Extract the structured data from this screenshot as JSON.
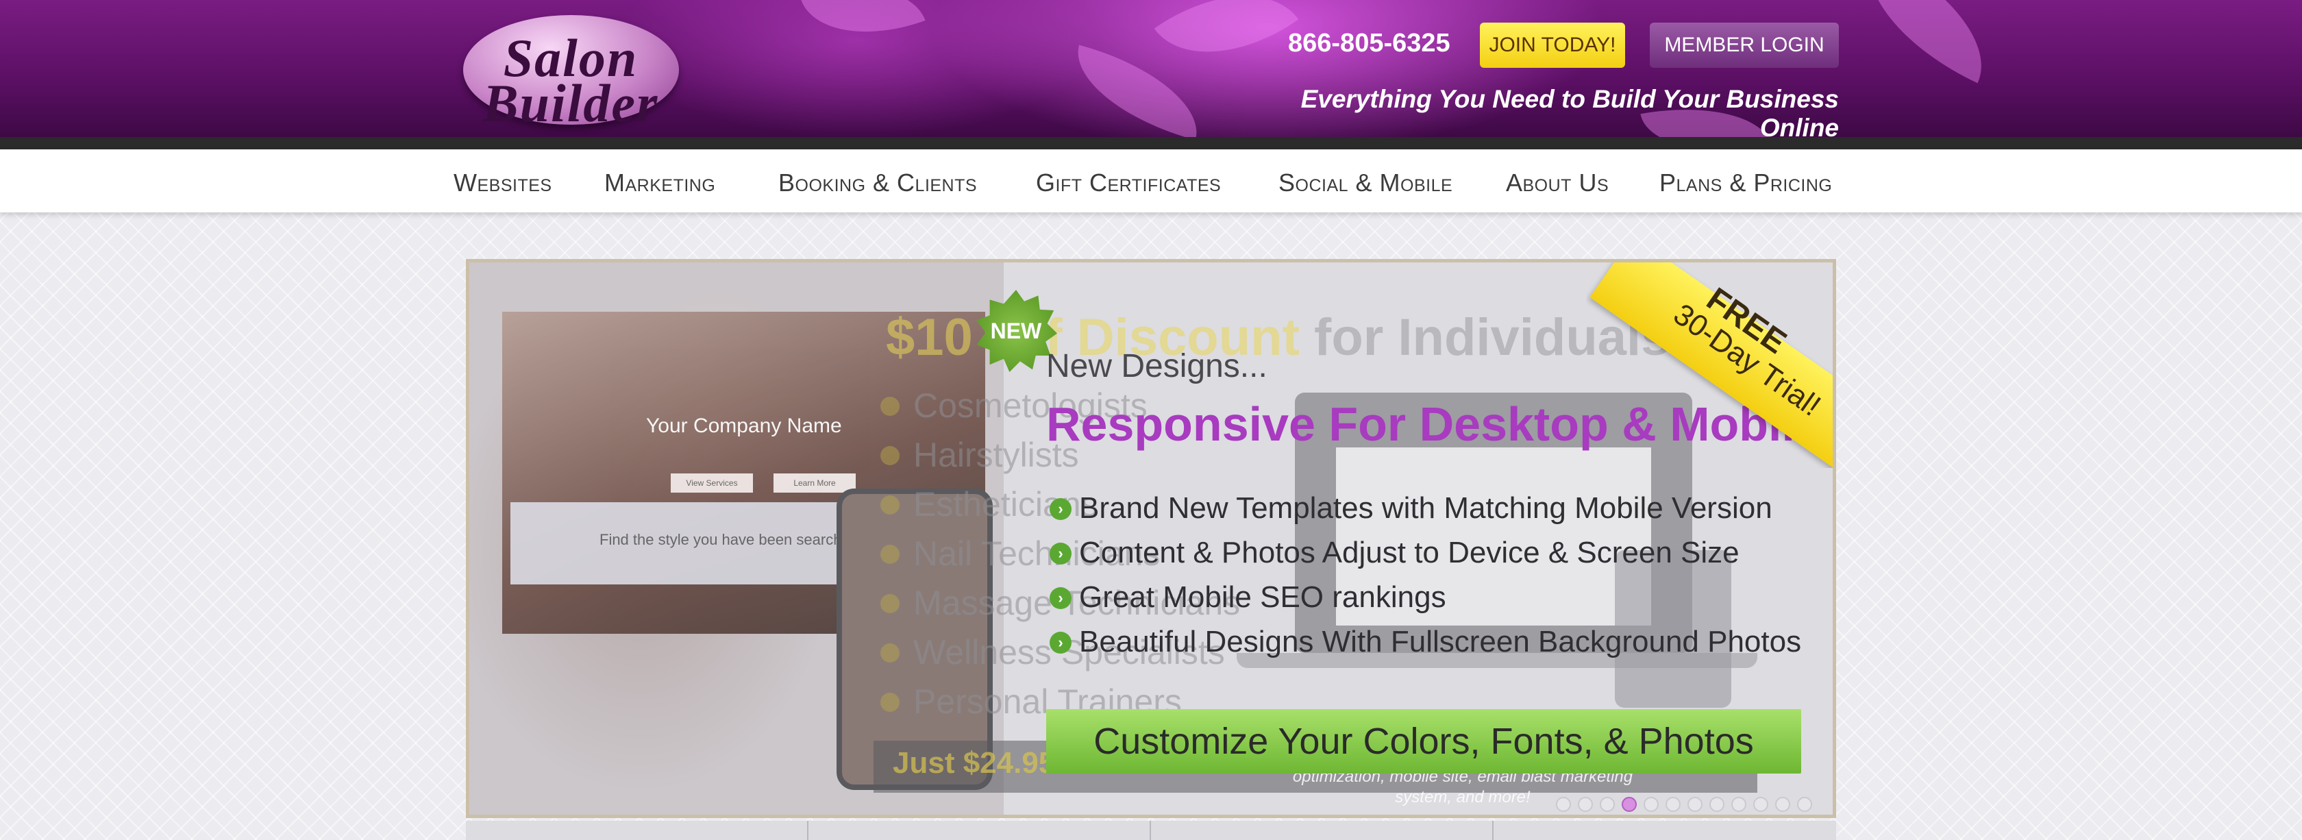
{
  "header": {
    "logo": {
      "line1": "Salon",
      "line2": "Builder"
    },
    "phone": "866-805-6325",
    "join_label": "JOIN TODAY!",
    "login_label": "MEMBER LOGIN",
    "tagline": "Everything You Need to Build Your Business Online"
  },
  "nav": {
    "items": [
      {
        "label": "Websites"
      },
      {
        "label": "Marketing"
      },
      {
        "label": "Booking & Clients"
      },
      {
        "label": "Gift Certificates"
      },
      {
        "label": "Social & Mobile"
      },
      {
        "label": "About Us"
      },
      {
        "label": "Plans & Pricing"
      }
    ]
  },
  "slider": {
    "ribbon": {
      "line1": "FREE",
      "line2": "30-Day Trial!"
    },
    "new_badge": "NEW",
    "subtitle": "New Designs...",
    "title": "Responsive For Desktop & Mobile",
    "features": [
      "Brand New Templates with Matching Mobile Version",
      "Content & Photos Adjust to Device & Screen Size",
      "Great Mobile SEO rankings",
      "Beautiful Designs With Fullscreen Background Photos"
    ],
    "cta_label": "Customize Your Colors, Fonts, & Photos",
    "mockup": {
      "company_name": "Your Company Name",
      "button1": "View Services",
      "button2": "Learn More",
      "search_text": "Find the style you have been searching for"
    },
    "previous_slide": {
      "headline_highlight": "$10 Off Discount",
      "headline_rest": " for Individuals",
      "items": [
        "Cosmetologists",
        "Hairstylists",
        "Estheticians",
        "Nail Technicians",
        "Massage Technicians",
        "Wellness Specialists",
        "Personal Trainers"
      ],
      "price": "Just $24.95/month!",
      "price_note": "for a complete package with website, search optimization, mobile site, email blast marketing system, and more!"
    },
    "dots": {
      "count": 12,
      "active_index": 3
    }
  },
  "colors": {
    "header_purple": "#5a0f63",
    "accent_yellow": "#f4cf12",
    "title_purple": "#a83bbf",
    "cta_green": "#6eb733"
  }
}
